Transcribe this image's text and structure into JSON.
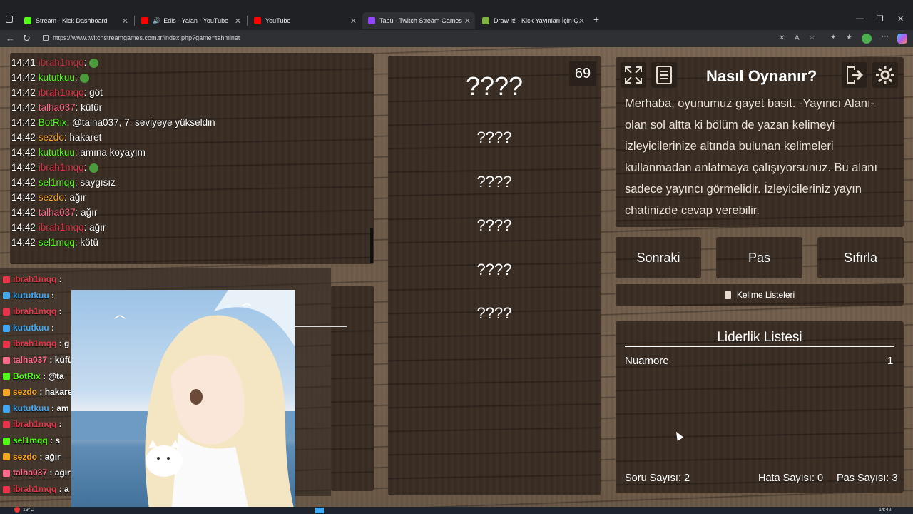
{
  "browser": {
    "tabs": [
      {
        "label": "Stream - Kick Dashboard",
        "color": "#53fc18"
      },
      {
        "label": "Edis - Yalan - YouTube",
        "color": "#ff0000"
      },
      {
        "label": "YouTube",
        "color": "#ff0000"
      },
      {
        "label": "Tabu - Twitch Stream Games",
        "color": "#9146ff"
      },
      {
        "label": "Draw It! - Kick Yayınları İçin Çizim",
        "color": "#7cb342"
      }
    ],
    "url": "https://www.twitchstreamgames.com.tr/index.php?game=tahminet"
  },
  "chat": [
    {
      "time": "14:42",
      "user": "kututkuu",
      "color": "#53fc18",
      "msg": ""
    },
    {
      "time": "14:42",
      "user": "ibrah1mqq",
      "color": "#e8344a",
      "msg": "göt"
    },
    {
      "time": "14:42",
      "user": "talha037",
      "color": "#ff6b8a",
      "msg": "küfür"
    },
    {
      "time": "14:42",
      "user": "BotRix",
      "color": "#53fc18",
      "msg": "@talha037, 7. seviyeye yükseldin"
    },
    {
      "time": "14:42",
      "user": "sezdo",
      "color": "#f5a623",
      "msg": "hakaret"
    },
    {
      "time": "14:42",
      "user": "kututkuu",
      "color": "#53fc18",
      "msg": "amına koyayım"
    },
    {
      "time": "14:42",
      "user": "ibrah1mqq",
      "color": "#e8344a",
      "msg": ""
    },
    {
      "time": "14:42",
      "user": "sel1mqq",
      "color": "#53fc18",
      "msg": "saygısız"
    },
    {
      "time": "14:42",
      "user": "sezdo",
      "color": "#f5a623",
      "msg": "ağır"
    },
    {
      "time": "14:42",
      "user": "talha037",
      "color": "#ff6b8a",
      "msg": "ağır"
    },
    {
      "time": "14:42",
      "user": "ibrah1mqq",
      "color": "#e8344a",
      "msg": "ağır"
    },
    {
      "time": "14:42",
      "user": "sel1mqq",
      "color": "#53fc18",
      "msg": "kötü"
    }
  ],
  "chat_first": {
    "time": "14:41",
    "user": "ibrah1mqq",
    "color": "#e8344a"
  },
  "twitch_chat": [
    {
      "user": "ibrah1mqq",
      "color": "#e8344a",
      "msg": ""
    },
    {
      "user": "kututkuu",
      "color": "#3fa9f5",
      "msg": ""
    },
    {
      "user": "ibrah1mqq",
      "color": "#e8344a",
      "msg": ""
    },
    {
      "user": "kututkuu",
      "color": "#3fa9f5",
      "msg": ""
    },
    {
      "user": "ibrah1mqq",
      "color": "#e8344a",
      "msg": "g"
    },
    {
      "user": "talha037",
      "color": "#ff6b8a",
      "msg": "küfür"
    },
    {
      "user": "BotRix",
      "color": "#53fc18",
      "msg": "@ta"
    },
    {
      "user": "sezdo",
      "color": "#f5a623",
      "msg": "hakare"
    },
    {
      "user": "kututkuu",
      "color": "#3fa9f5",
      "msg": "am"
    },
    {
      "user": "ibrah1mqq",
      "color": "#e8344a",
      "msg": ""
    },
    {
      "user": "sel1mqq",
      "color": "#53fc18",
      "msg": "s"
    },
    {
      "user": "sezdo",
      "color": "#f5a623",
      "msg": "ağır"
    },
    {
      "user": "talha037",
      "color": "#ff6b8a",
      "msg": "ağır"
    },
    {
      "user": "ibrah1mqq",
      "color": "#e8344a",
      "msg": "a"
    }
  ],
  "game": {
    "score": "69",
    "main_word": "????",
    "words": [
      "????",
      "????",
      "????",
      "????",
      "????"
    ]
  },
  "howto": {
    "title": "Nasıl Oynanır?",
    "text": "Merhaba, oyunumuz gayet basit. -Yayıncı Alanı- olan sol altta ki bölüm de yazan kelimeyi izleyicilerinize altında bulunan kelimeleri kullanmadan anlatmaya çalışıyorsunuz. Bu alanı sadece yayıncı görmelidir. İzleyicileriniz yayın chatinizde cevap verebilir."
  },
  "buttons": {
    "next": "Sonraki",
    "pass": "Pas",
    "reset": "Sıfırla",
    "word_lists": "Kelime Listeleri"
  },
  "leaderboard": {
    "title": "Liderlik Listesi",
    "rows": [
      {
        "name": "Nuamore",
        "score": "1"
      }
    ]
  },
  "stats": {
    "questions": "Soru Sayısı: 2",
    "errors": "Hata Sayısı: 0",
    "passes": "Pas Sayısı: 3"
  },
  "taskbar": {
    "weather": "19°C",
    "clock": "14:42"
  }
}
